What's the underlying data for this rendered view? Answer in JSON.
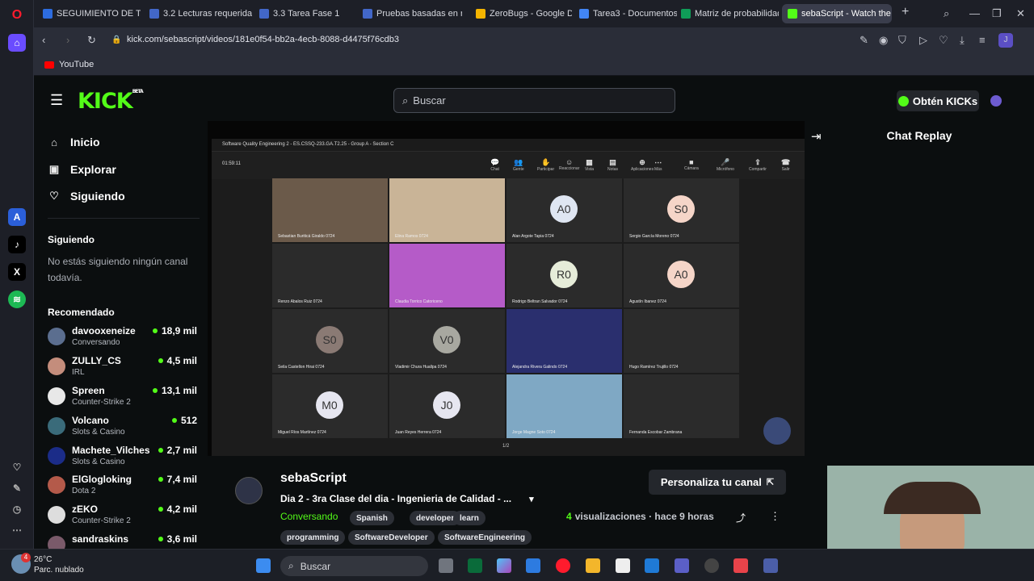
{
  "browser": {
    "tabs": [
      {
        "label": "SEGUIMIENTO DE TAREAS",
        "color": "#2d6cdf"
      },
      {
        "label": "3.2 Lecturas requeridas",
        "color": "#4267c8"
      },
      {
        "label": "3.3 Tarea Fase 1",
        "color": "#4267c8"
      },
      {
        "label": "Pruebas basadas en riesgo",
        "color": "#4267c8"
      },
      {
        "label": "ZeroBugs - Google Drive",
        "color": "#f4b400"
      },
      {
        "label": "Tarea3 - Documentos de Google",
        "color": "#4285f4"
      },
      {
        "label": "Matriz de probabilidad",
        "color": "#0f9d58"
      },
      {
        "label": "sebaScript - Watch the",
        "color": "#53fc18"
      }
    ],
    "new_tab": "+",
    "url": "kick.com/sebascript/videos/181e0f54-bb2a-4ecb-8088-d4475f76cdb3",
    "bookmark": "YouTube"
  },
  "kick": {
    "logo": "KICK",
    "beta": "BETA",
    "search_placeholder": "Buscar",
    "kicks_button": "Obtén KICKs",
    "nav": {
      "home": "Inicio",
      "explore": "Explorar",
      "following": "Siguiendo"
    },
    "following_title": "Siguiendo",
    "following_empty": "No estás siguiendo ningún canal todavía.",
    "recommended_title": "Recomendado",
    "recommended": [
      {
        "name": "davooxeneize",
        "category": "Conversando",
        "viewers": "18,9 mil",
        "color": "#5b6e8f"
      },
      {
        "name": "ZULLY_CS",
        "category": "IRL",
        "viewers": "4,5 mil",
        "color": "#c48d7c"
      },
      {
        "name": "Spreen",
        "category": "Counter-Strike 2",
        "viewers": "13,1 mil",
        "color": "#e8e8e8"
      },
      {
        "name": "Volcano",
        "category": "Slots & Casino",
        "viewers": "512",
        "color": "#3a6b7a"
      },
      {
        "name": "Machete_Vilches",
        "category": "Slots & Casino",
        "viewers": "2,7 mil",
        "color": "#1b2c88"
      },
      {
        "name": "ElGlogloking",
        "category": "Dota 2",
        "viewers": "7,4 mil",
        "color": "#b45a4a"
      },
      {
        "name": "zEKO",
        "category": "Counter-Strike 2",
        "viewers": "4,2 mil",
        "color": "#dddddd"
      },
      {
        "name": "sandraskins",
        "category": "",
        "viewers": "3,6 mil",
        "color": "#7a5a6a"
      }
    ],
    "chat_title": "Chat Replay",
    "channel": {
      "name": "sebaScript",
      "title": "Dia 2 - 3ra Clase del dia - Ingenieria de Calidad - ...",
      "category": "Conversando",
      "tags": [
        "Spanish",
        "developer",
        "learn",
        "programming",
        "SoftwareDeveloper",
        "SoftwareEngineering"
      ],
      "customize_button": "Personaliza tu canal",
      "views_count": "4",
      "views_label": "visualizaciones",
      "time_ago": "hace 9 horas"
    }
  },
  "zoom": {
    "title": "Software Quality Engineering 2 - ES.CSSQ-233.GA.T2.25 - Group A - Section C",
    "timer": "01:59:11",
    "tools": [
      {
        "icon": "💬",
        "label": "Chat"
      },
      {
        "icon": "👥",
        "label": "Gente"
      },
      {
        "icon": "✋",
        "label": "Participar"
      },
      {
        "icon": "☺",
        "label": "Reaccionar"
      },
      {
        "icon": "▦",
        "label": "Vista"
      },
      {
        "icon": "▤",
        "label": "Notas"
      },
      {
        "icon": "⊕",
        "label": "Aplicaciones"
      },
      {
        "icon": "⋯",
        "label": "Más"
      },
      {
        "icon": "■",
        "label": "Cámara"
      },
      {
        "icon": "🎤",
        "label": "Micrófono"
      },
      {
        "icon": "⇪",
        "label": "Compartir"
      },
      {
        "icon": "☎",
        "label": "Salir"
      }
    ],
    "reactions": "👍 💖 👏 😂 😮",
    "participants": [
      {
        "initials": "",
        "name": "Sebastian Buriticá Giraldo 0724",
        "bg": "#6b5a4a",
        "photo": true
      },
      {
        "initials": "",
        "name": "Elina Ramos 0724",
        "bg": "#c9b497",
        "photo": true
      },
      {
        "initials": "A0",
        "name": "Alan Argote Tapia 0724",
        "bg": "#dfe6f2",
        "photo": false
      },
      {
        "initials": "S0",
        "name": "Sergio García Moreno 0724",
        "bg": "#f5d5c8",
        "photo": false
      },
      {
        "initials": "",
        "name": "Renzo Abalos Ruiz 0724",
        "bg": "#2b2b2b",
        "photo": true
      },
      {
        "initials": "",
        "name": "Claudia Torrico Catoriceno",
        "bg": "#b55bc8",
        "photo": true
      },
      {
        "initials": "R0",
        "name": "Rodrigo Beltran Salvador 0724",
        "bg": "#e6ecd9",
        "photo": false
      },
      {
        "initials": "A0",
        "name": "Agustín Ibanez 0724",
        "bg": "#f5d5c8",
        "photo": false
      },
      {
        "initials": "S0",
        "name": "Seila Castellon Hirai 0724",
        "bg": "#8a7a74",
        "photo": false
      },
      {
        "initials": "V0",
        "name": "Vladimir Chura Huallpa 0724",
        "bg": "#a8a8a0",
        "photo": false
      },
      {
        "initials": "",
        "name": "Alejandra Rivera Galindo 0724",
        "bg": "#2a2f6e",
        "photo": true
      },
      {
        "initials": "",
        "name": "Hugo Ramírez Trujillo 0724",
        "bg": "#2b2b2b",
        "photo": true
      },
      {
        "initials": "M0",
        "name": "Miguel Ríos Martínez 0724",
        "bg": "#e6e6f0",
        "photo": false
      },
      {
        "initials": "J0",
        "name": "Juan Reyes Herrera 0724",
        "bg": "#e6e6f0",
        "photo": false
      },
      {
        "initials": "",
        "name": "Jorge Magne Soto 0724",
        "bg": "#7fa8c4",
        "photo": true
      },
      {
        "initials": "",
        "name": "Fernanda Escobar Zambrana",
        "bg": "#2b2b2b",
        "photo": true
      }
    ],
    "page": "1/2"
  },
  "taskbar": {
    "temp": "26°C",
    "weather": "Parc. nublado",
    "search": "Buscar",
    "badge": "4"
  }
}
